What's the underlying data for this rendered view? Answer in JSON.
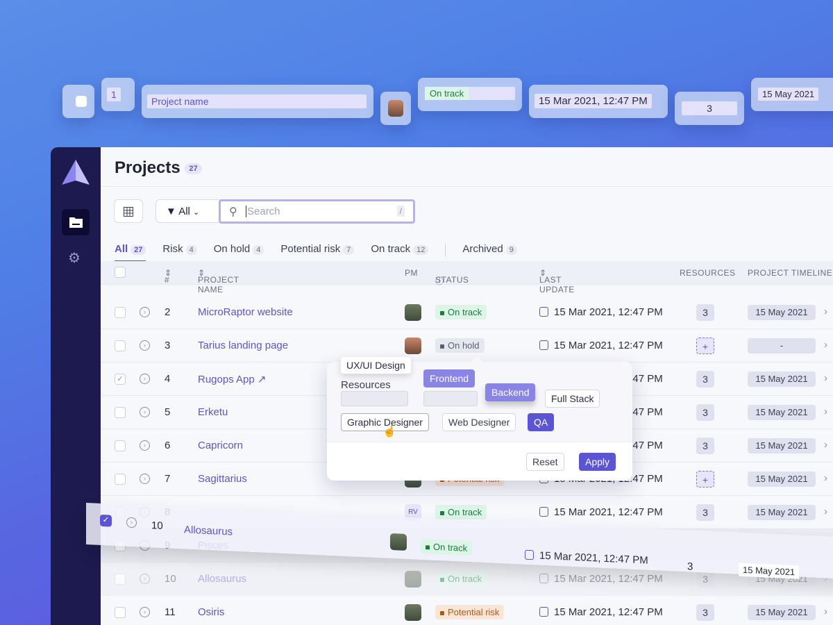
{
  "floating": {
    "number": "1",
    "project_name": "Project name",
    "status": "On track",
    "last_update": "15 Mar 2021, 12:47 PM",
    "resources": "3",
    "timeline": "15 May 2021"
  },
  "header": {
    "title": "Projects",
    "count": "27"
  },
  "toolbar": {
    "filter_label": "All",
    "search_placeholder": "Search",
    "shortcut": "/"
  },
  "tabs": [
    {
      "label": "All",
      "count": "27"
    },
    {
      "label": "Risk",
      "count": "4"
    },
    {
      "label": "On hold",
      "count": "4"
    },
    {
      "label": "Potential risk",
      "count": "7"
    },
    {
      "label": "On track",
      "count": "12"
    },
    {
      "label": "Archived",
      "count": "9"
    }
  ],
  "columns": {
    "num": "#",
    "name": "PROJECT NAME",
    "pm": "PM",
    "status": "STATUS",
    "last_update": "LAST UPDATE",
    "resources": "RESOURCES",
    "timeline": "PROJECT TIMELINE"
  },
  "rows": [
    {
      "num": "2",
      "name": "MicroRaptor website",
      "status": "On track",
      "kind": "ok",
      "update": "15 Mar 2021, 12:47 PM",
      "res": "3",
      "timeline": "15 May 2021"
    },
    {
      "num": "3",
      "name": "Tarius landing page",
      "status": "On hold",
      "kind": "hold",
      "update": "15 Mar 2021, 12:47 PM",
      "res": "+",
      "timeline": "-"
    },
    {
      "num": "4",
      "name": "Rugops App",
      "status": "",
      "kind": "ok",
      "update": "15 Mar 2021, 12:47 PM",
      "res": "3",
      "timeline": "15 May 2021"
    },
    {
      "num": "5",
      "name": "Erketu",
      "status": "",
      "kind": "ok",
      "update": "15 Mar 2021, 12:47 PM",
      "res": "3",
      "timeline": "15 May 2021"
    },
    {
      "num": "6",
      "name": "Capricorn",
      "status": "",
      "kind": "ok",
      "update": "15 Mar 2021, 12:47 PM",
      "res": "3",
      "timeline": "15 May 2021"
    },
    {
      "num": "7",
      "name": "Sagittarius",
      "status": "Potential risk",
      "kind": "risk",
      "update": "15 Mar 2021, 12:47 PM",
      "res": "+",
      "timeline": "15 May 2021"
    },
    {
      "num": "8",
      "name": "",
      "status": "On track",
      "kind": "ok",
      "update": "15 Mar 2021, 12:47 PM",
      "res": "3",
      "timeline": "15 May 2021",
      "pm": "RV"
    },
    {
      "num": "9",
      "name": "Pisces",
      "status": "",
      "kind": "ok",
      "update": "",
      "res": "",
      "timeline": ""
    },
    {
      "num": "10",
      "name": "Allosaurus",
      "status": "On track",
      "kind": "ok",
      "update": "15 Mar 2021, 12:47 PM",
      "res": "3",
      "timeline": "15 May 2021"
    },
    {
      "num": "11",
      "name": "Osiris",
      "status": "Potential risk",
      "kind": "risk",
      "update": "15 Mar 2021, 12:47 PM",
      "res": "3",
      "timeline": "15 May 2021"
    }
  ],
  "dragged_row": {
    "num": "10",
    "name": "Allosaurus",
    "status": "On track",
    "update": "15 Mar 2021, 12:47 PM",
    "res": "3",
    "timeline": "15 May 2021"
  },
  "popover": {
    "tooltip": "UX/UI Design",
    "title": "Resources",
    "chips": [
      "Frontend",
      "Backend",
      "Full Stack",
      "Graphic Designer",
      "Web Designer",
      "QA"
    ],
    "reset": "Reset",
    "apply": "Apply"
  },
  "colors": {
    "accent": "#5b55d6",
    "sidebar": "#1c1a4f"
  }
}
